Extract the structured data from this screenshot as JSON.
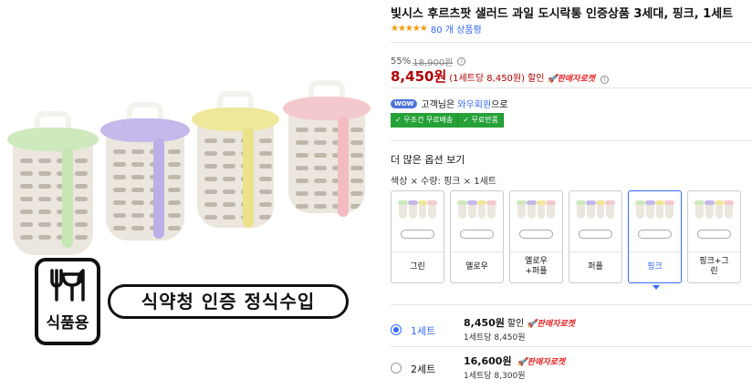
{
  "hero": {
    "colors": {
      "green": "#cfe9bf",
      "purple": "#c5b8ea",
      "yellow": "#efe79a",
      "pink": "#f4c9ce"
    },
    "badge_label": "식품용",
    "badge_icon": "utensils-icon",
    "cert_text": "식약청 인증 정식수입"
  },
  "product": {
    "title": "빛시스 후르츠팟 샐러드 과일 도시락통 인증상품 3세대, 핑크, 1세트",
    "stars": "★★★★★",
    "review_count": "80 개 상품평",
    "discount_rate": "55%",
    "original_price": "18,900원",
    "price": "8,450원",
    "unit_price": "(1세트당 8,450원)",
    "sale_label": "할인",
    "rocket_label": "판매자로켓",
    "wow_badge": "WOW",
    "wow_text_pre": "고객님은 ",
    "wow_link": "와우회원",
    "wow_text_post": "으로",
    "ship_tags": [
      "✓ 무조건 무료배송",
      "✓ 무료반품"
    ]
  },
  "options": {
    "header": "더 많은 옵션 보기",
    "selected_summary": "색상 × 수량: 핑크 × 1세트",
    "items": [
      {
        "name": "그린",
        "selected": false
      },
      {
        "name": "옐로우",
        "selected": false
      },
      {
        "name": "옐로우\n+퍼플",
        "selected": false
      },
      {
        "name": "퍼플",
        "selected": false
      },
      {
        "name": "핑크",
        "selected": true
      },
      {
        "name": "핑크+그\n린",
        "selected": false
      }
    ]
  },
  "quantities": [
    {
      "label": "1세트",
      "price": "8,450원",
      "sale": "할인",
      "rocket": "판매자로켓",
      "unit": "1세트당 8,450원",
      "selected": true
    },
    {
      "label": "2세트",
      "price": "16,600원",
      "sale": "",
      "rocket": "판매자로켓",
      "unit": "1세트당 8,300원",
      "selected": false
    }
  ]
}
